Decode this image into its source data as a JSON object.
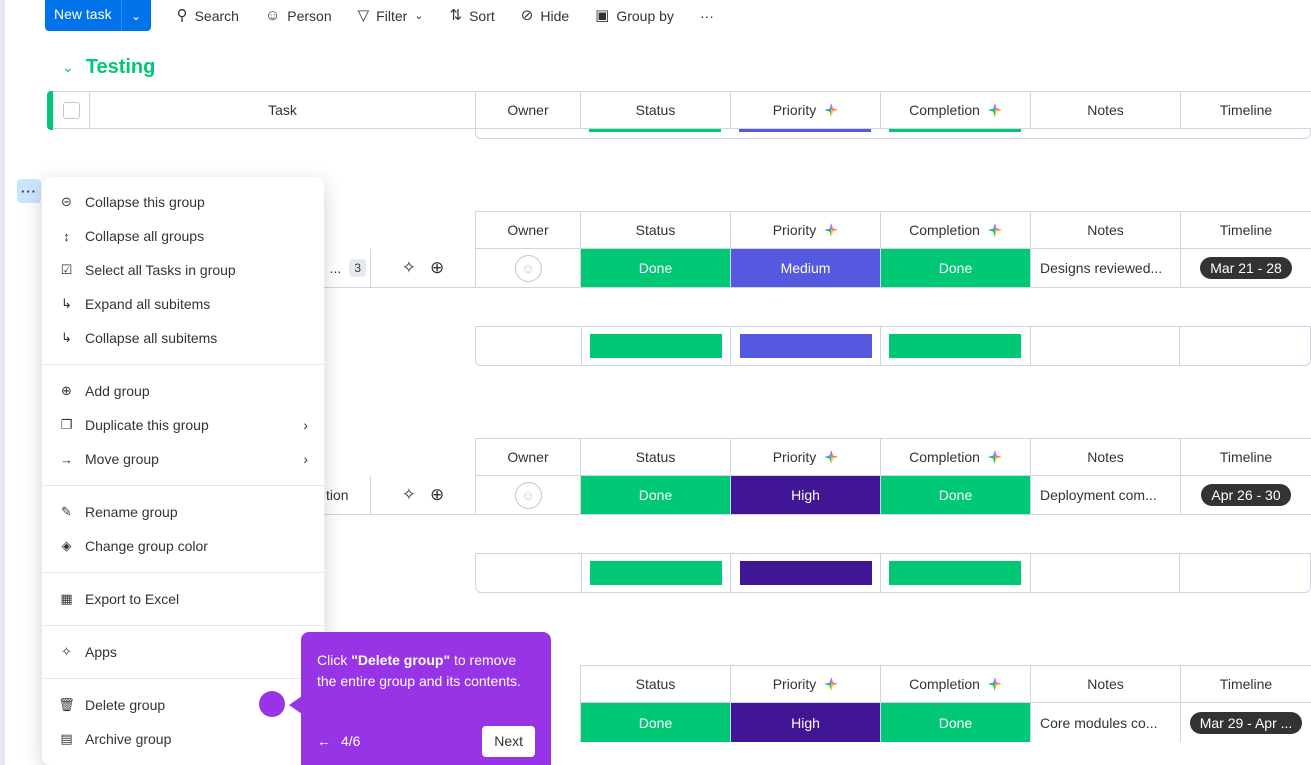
{
  "toolbar": {
    "new_task": "New task",
    "search": "Search",
    "person": "Person",
    "filter": "Filter",
    "sort": "Sort",
    "hide": "Hide",
    "group_by": "Group by",
    "more": "···"
  },
  "group_title": "Testing",
  "columns": {
    "task": "Task",
    "owner": "Owner",
    "status": "Status",
    "priority": "Priority",
    "completion": "Completion",
    "notes": "Notes",
    "timeline": "Timeline"
  },
  "rows": [
    {
      "task_fragment": "...",
      "subitems": "3",
      "status": "Done",
      "priority": "Medium",
      "completion": "Done",
      "notes": "Designs reviewed...",
      "timeline": "Mar 21 - 28"
    },
    {
      "task_fragment": "tion",
      "status": "Done",
      "priority": "High",
      "completion": "Done",
      "notes": "Deployment com...",
      "timeline": "Apr 26 - 30"
    },
    {
      "status": "Done",
      "priority": "High",
      "completion": "Done",
      "notes": "Core modules co...",
      "timeline": "Mar 29 - Apr ..."
    }
  ],
  "colors": {
    "done": "#00c875",
    "medium": "#5559df",
    "high": "#401694",
    "accent": "#0073ea",
    "tooltip": "#9734e6"
  },
  "menu": {
    "dots": "···",
    "items": [
      {
        "label": "Collapse this group",
        "icon": "collapse-circle-icon"
      },
      {
        "label": "Collapse all groups",
        "icon": "collapse-arrows-icon"
      },
      {
        "label": "Select all Tasks in group",
        "icon": "checkbox-icon"
      },
      {
        "label": "Expand all subitems",
        "icon": "subitems-icon"
      },
      {
        "label": "Collapse all subitems",
        "icon": "subitems-icon"
      },
      {
        "label": "Add group",
        "icon": "add-circle-icon"
      },
      {
        "label": "Duplicate this group",
        "icon": "duplicate-icon"
      },
      {
        "label": "Move group",
        "icon": "arrow-right-icon"
      },
      {
        "label": "Rename group",
        "icon": "pencil-icon"
      },
      {
        "label": "Change group color",
        "icon": "paint-bucket-icon"
      },
      {
        "label": "Export to Excel",
        "icon": "excel-icon"
      },
      {
        "label": "Apps",
        "icon": "puzzle-icon"
      },
      {
        "label": "Delete group",
        "icon": "trash-icon"
      },
      {
        "label": "Archive group",
        "icon": "archive-icon"
      }
    ]
  },
  "tooltip": {
    "prefix": "Click ",
    "bold": "\"Delete group\"",
    "suffix": " to remove the entire group and its contents.",
    "step": "4/6",
    "next": "Next"
  }
}
